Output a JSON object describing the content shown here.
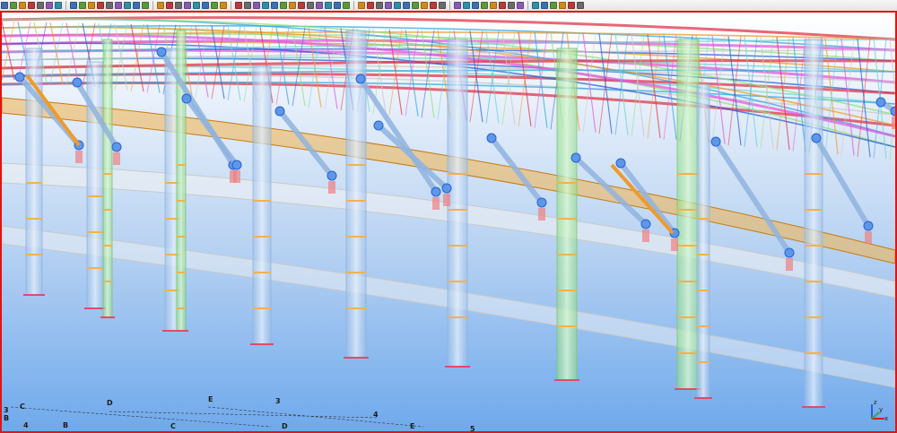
{
  "toolbar": {
    "groups": [
      [
        "select-tool",
        "line-tool",
        "polyline-tool",
        "arc-tool",
        "measure-tool",
        "camera-tool",
        "pan-tool"
      ],
      [
        "home-tool",
        "layers-tool",
        "filter-tool",
        "properties-tool",
        "clip-tool",
        "print-tool",
        "export-tool",
        "settings-tool",
        "close-tool"
      ],
      [
        "snap-end",
        "snap-mid",
        "snap-int",
        "snap-perp",
        "snap-near",
        "snap-center",
        "snap-grid",
        "snap-free"
      ],
      [
        "new-tool",
        "open-tool",
        "save-tool",
        "undo-tool",
        "redo-tool",
        "copy-tool",
        "paste-tool",
        "delete-tool",
        "move-tool",
        "rotate-tool",
        "mirror-tool",
        "array-tool",
        "offset-tool"
      ],
      [
        "view-front",
        "view-back",
        "view-top",
        "view-iso",
        "zoom-in",
        "zoom-out",
        "zoom-fit",
        "zoom-window",
        "render-wire",
        "render-shaded"
      ],
      [
        "part-beam",
        "part-column",
        "part-plate",
        "part-bolt",
        "part-weld",
        "part-cut",
        "part-fitting",
        "part-rebar"
      ],
      [
        "report-tool",
        "drawing-tool",
        "check-tool",
        "clash-tool",
        "help-tool",
        "info-tool"
      ]
    ],
    "colors": [
      "#3c6fb4",
      "#5a9a3c",
      "#d08a1c",
      "#b83a3a",
      "#6b6b6b",
      "#8a5ab0",
      "#2f8fa8"
    ]
  },
  "grid_labels": {
    "left_3": "3",
    "left_b": "B",
    "left_4": "4",
    "row_c1": "C",
    "row_b": "B",
    "row_d1": "D",
    "row_c2": "C",
    "row_e1": "E",
    "row_3": "3",
    "row_d2": "D",
    "row_4": "4",
    "row_e2": "E",
    "row_5": "5"
  },
  "axes": {
    "x": "x",
    "y": "y",
    "z": "z"
  },
  "colors": {
    "viewport_border": "#e01414",
    "truss_colors": [
      "#e2364a",
      "#2fa8e6",
      "#8fe07a",
      "#f09a2a",
      "#e15adf",
      "#2a5fd8",
      "#6fd4d0",
      "#c9c9c9"
    ],
    "column_fill": "#c9dcf4",
    "column_green_fill": "#b8ecb0",
    "ring_beam": "#f2b24a"
  }
}
